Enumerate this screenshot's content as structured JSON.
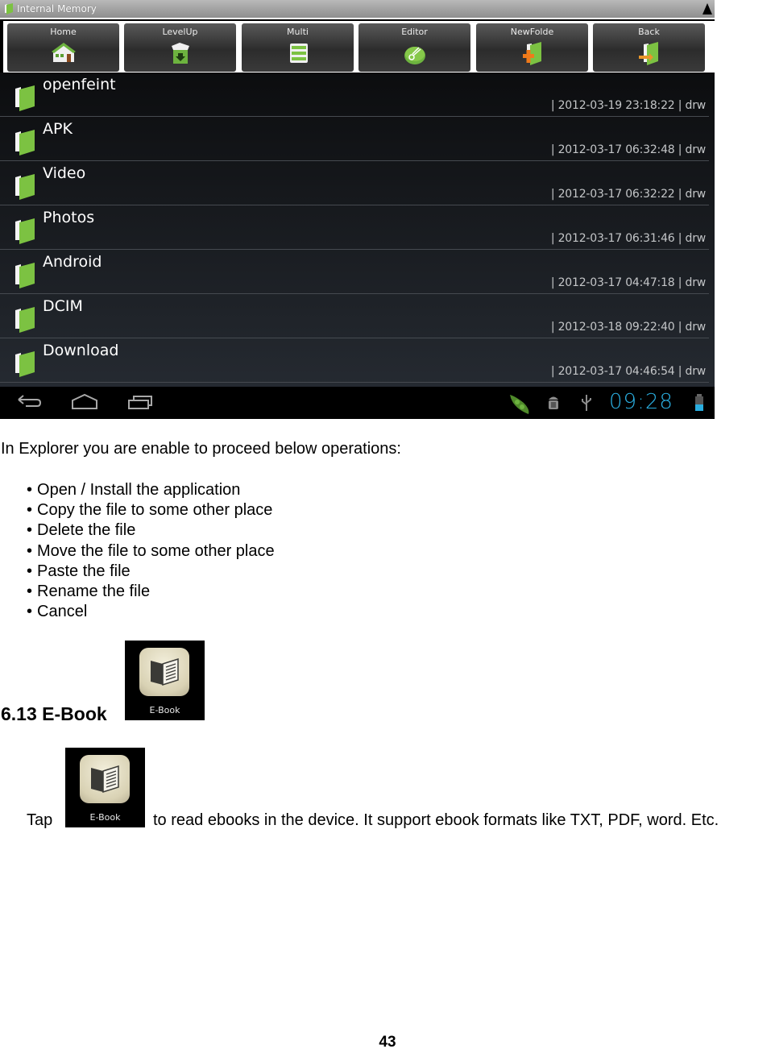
{
  "screenshot": {
    "title": "Internal Memory",
    "toolbar": [
      {
        "label": "Home",
        "icon": "home-icon"
      },
      {
        "label": "LevelUp",
        "icon": "level-up-icon"
      },
      {
        "label": "Multi",
        "icon": "multi-select-icon"
      },
      {
        "label": "Editor",
        "icon": "editor-scissors-icon"
      },
      {
        "label": "NewFolde",
        "icon": "new-folder-icon"
      },
      {
        "label": "Back",
        "icon": "back-folder-icon"
      }
    ],
    "folders": [
      {
        "name": "openfeint",
        "meta": "| 2012-03-19 23:18:22 | drw"
      },
      {
        "name": "APK",
        "meta": "| 2012-03-17 06:32:48 | drw"
      },
      {
        "name": "Video",
        "meta": "| 2012-03-17 06:32:22 | drw"
      },
      {
        "name": "Photos",
        "meta": "| 2012-03-17 06:31:46 | drw"
      },
      {
        "name": "Android",
        "meta": "| 2012-03-17 04:47:18 | drw"
      },
      {
        "name": "DCIM",
        "meta": "| 2012-03-18 09:22:40 | drw"
      },
      {
        "name": "Download",
        "meta": "| 2012-03-17 04:46:54 | drw"
      }
    ],
    "statusbar": {
      "clock": "09:28",
      "clock_color": "#2aaee0",
      "accent_green": "#7cc242"
    }
  },
  "document": {
    "intro": "In Explorer you are enable to proceed below operations:",
    "operations": [
      "Open / Install the application",
      "Copy the file to some other place",
      "Delete the file",
      "Move the file to some other place",
      "Paste the file",
      "Rename the file",
      "Cancel"
    ],
    "section_heading": "6.13 E-Book",
    "icon_caption": "E-Book",
    "tap_prefix": "Tap",
    "tap_suffix": "to read ebooks in the device. It support ebook formats like TXT, PDF, word. Etc.",
    "page_number": "43"
  }
}
